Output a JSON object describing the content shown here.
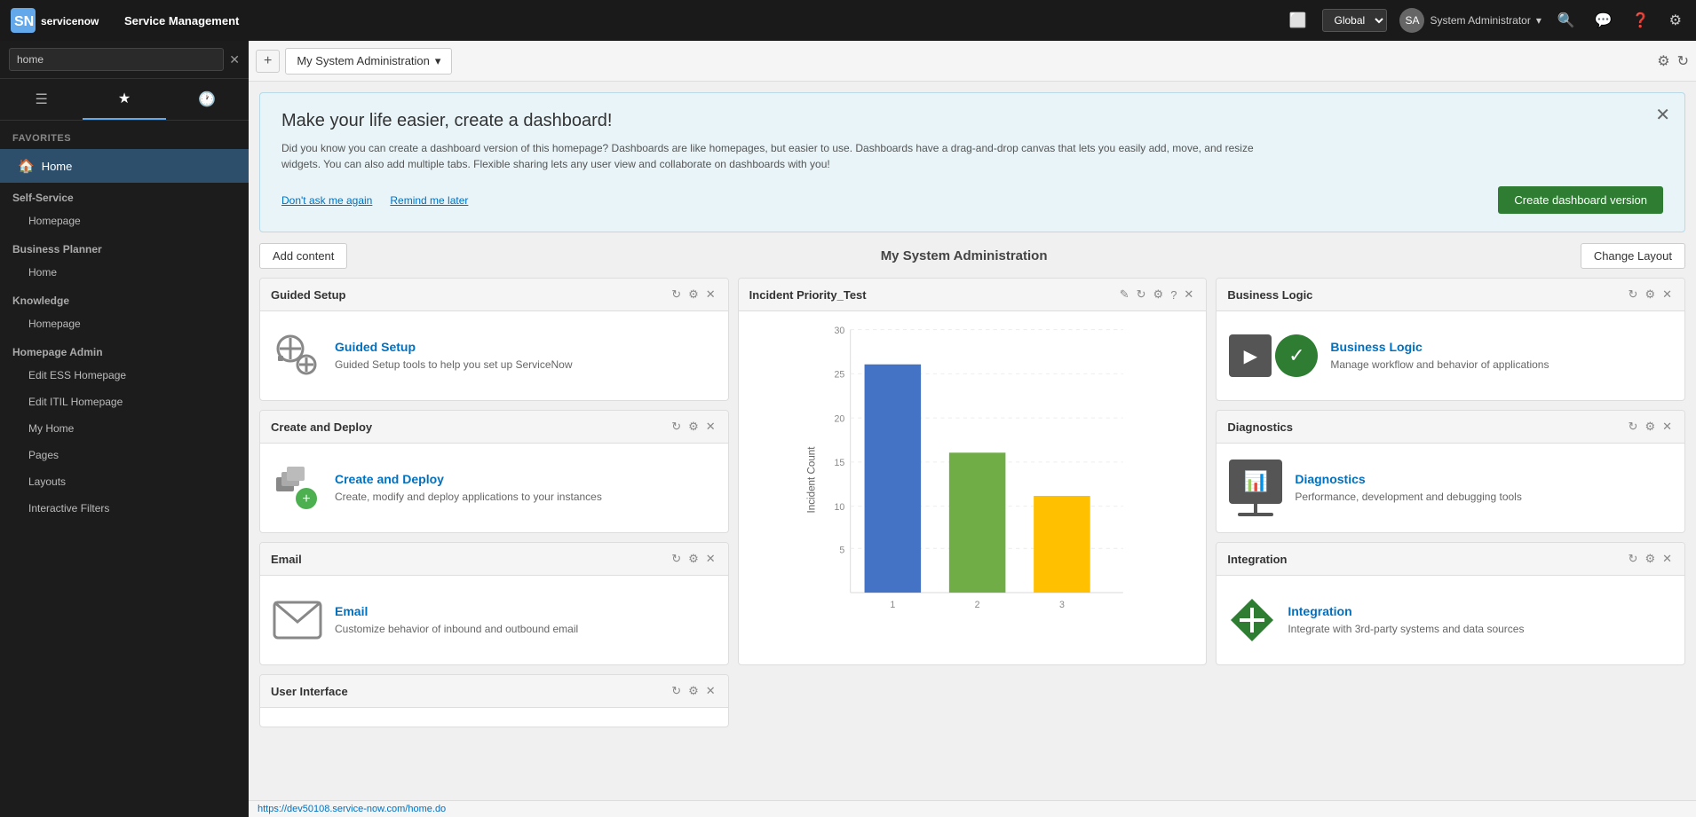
{
  "app": {
    "brand": "servicenow",
    "service_name": "Service Management"
  },
  "topnav": {
    "global_label": "Global",
    "user_name": "System Administrator",
    "user_initials": "SA",
    "search_placeholder": "Search",
    "settings_label": "Settings",
    "help_label": "Help",
    "chat_label": "Chat",
    "screen_label": "Screen"
  },
  "tabbar": {
    "new_tab_label": "+",
    "active_tab_label": "My System Administration",
    "dropdown_icon": "▾",
    "settings_icon": "⚙",
    "refresh_icon": "↻"
  },
  "sidebar": {
    "search_value": "home",
    "search_placeholder": "home",
    "sections": [
      {
        "label": "Favorites",
        "items": [
          {
            "icon": "🏠",
            "label": "Home",
            "active": true
          }
        ]
      }
    ],
    "groups": [
      {
        "label": "Self-Service",
        "items": [
          {
            "label": "Homepage"
          }
        ]
      },
      {
        "label": "Business Planner",
        "items": [
          {
            "label": "Home"
          }
        ]
      },
      {
        "label": "Knowledge",
        "items": [
          {
            "label": "Homepage"
          }
        ]
      },
      {
        "label": "Homepage Admin",
        "items": [
          {
            "label": "Edit ESS Homepage"
          },
          {
            "label": "Edit ITIL Homepage"
          },
          {
            "label": "My Home"
          },
          {
            "label": "Pages"
          },
          {
            "label": "Layouts"
          },
          {
            "label": "Interactive Filters"
          }
        ]
      }
    ]
  },
  "banner": {
    "title": "Make your life easier, create a dashboard!",
    "text": "Did you know you can create a dashboard version of this homepage? Dashboards are like homepages, but easier to use. Dashboards have a drag-and-drop canvas that lets you easily add, move, and resize widgets. You can also add multiple tabs. Flexible sharing lets any user view and collaborate on dashboards with you!",
    "dont_ask_label": "Don't ask me again",
    "remind_label": "Remind me later",
    "create_btn_label": "Create dashboard version"
  },
  "page": {
    "title": "My System Administration",
    "add_content_label": "Add content",
    "change_layout_label": "Change Layout"
  },
  "widgets": {
    "guided_setup": {
      "header": "Guided Setup",
      "title": "Guided Setup",
      "description": "Guided Setup tools to help you set up ServiceNow"
    },
    "create_deploy": {
      "header": "Create and Deploy",
      "title": "Create and Deploy",
      "description": "Create, modify and deploy applications to your instances"
    },
    "email": {
      "header": "Email",
      "title": "Email",
      "description": "Customize behavior of inbound and outbound email"
    },
    "incident_chart": {
      "header": "Incident Priority_Test",
      "y_label": "Incident Count",
      "y_values": [
        5,
        10,
        15,
        20,
        25,
        30
      ],
      "bars": [
        {
          "label": "1",
          "value": 26,
          "color": "#4472c4"
        },
        {
          "label": "2",
          "value": 16,
          "color": "#70ad47"
        },
        {
          "label": "3",
          "value": 11,
          "color": "#ffc000"
        }
      ]
    },
    "business_logic": {
      "header": "Business Logic",
      "title": "Business Logic",
      "description": "Manage workflow and behavior of applications"
    },
    "diagnostics": {
      "header": "Diagnostics",
      "title": "Diagnostics",
      "description": "Performance, development and debugging tools"
    },
    "integration": {
      "header": "Integration",
      "title": "Integration",
      "description": "Integrate with 3rd-party systems and data sources"
    },
    "user_interface": {
      "header": "User Interface"
    }
  },
  "statusbar": {
    "url": "https://dev50108.service-now.com/home.do"
  }
}
